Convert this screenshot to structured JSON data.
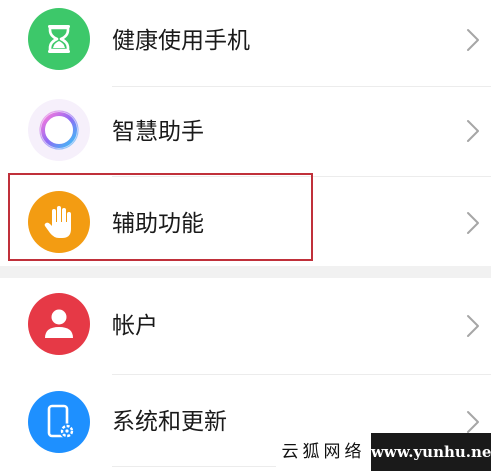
{
  "settings": {
    "items": [
      {
        "label": "健康使用手机",
        "icon": "hourglass-icon",
        "color": "#3dc86a"
      },
      {
        "label": "智慧助手",
        "icon": "assistant-ring-icon",
        "color": "#b06ff0"
      },
      {
        "label": "辅助功能",
        "icon": "hand-icon",
        "color": "#f39c12"
      },
      {
        "label": "帐户",
        "icon": "user-icon",
        "color": "#e63946"
      },
      {
        "label": "系统和更新",
        "icon": "phone-settings-icon",
        "color": "#1e90ff"
      }
    ]
  },
  "watermark": {
    "cn_text": "云狐网络",
    "url": "www.yunhu.net"
  }
}
